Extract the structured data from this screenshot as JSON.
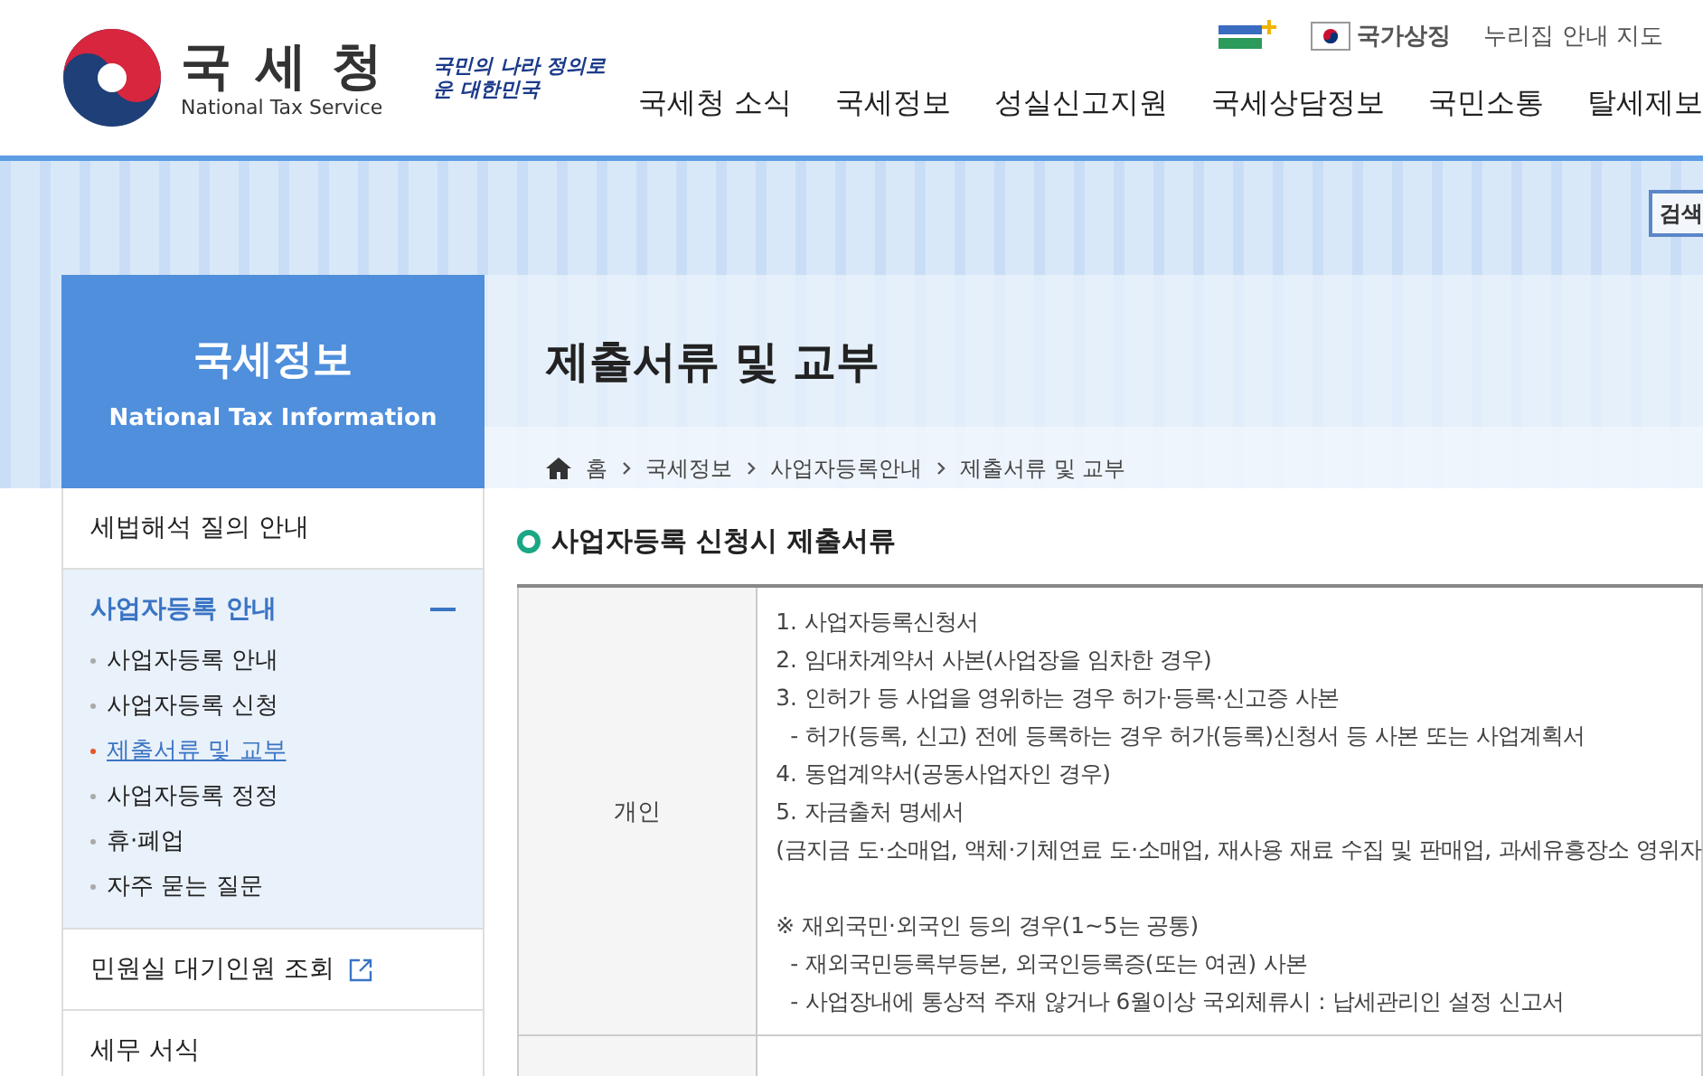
{
  "header": {
    "logo": {
      "title": "국 세 청",
      "subtitle": "National Tax Service"
    },
    "slogan": "국민의 나라 정의로운 대한민국",
    "util_links": [
      {
        "kind": "flag",
        "label": "국가상징"
      },
      {
        "kind": "text",
        "label": "누리집 안내 지도"
      }
    ],
    "nav": [
      "국세청 소식",
      "국세정보",
      "성실신고지원",
      "국세상담정보",
      "국민소통",
      "탈세제보"
    ]
  },
  "banner": {
    "search_button": "검색"
  },
  "sidebar": {
    "title": "국세정보",
    "subtitle": "National Tax Information",
    "items": [
      {
        "label": "세법해석 질의 안내",
        "kind": "plain",
        "expanded": false
      },
      {
        "label": "사업자등록 안내",
        "kind": "plain",
        "expanded": true,
        "children": [
          {
            "label": "사업자등록 안내",
            "selected": false
          },
          {
            "label": "사업자등록 신청",
            "selected": false
          },
          {
            "label": "제출서류 및 교부",
            "selected": true
          },
          {
            "label": "사업자등록 정정",
            "selected": false
          },
          {
            "label": "휴·폐업",
            "selected": false
          },
          {
            "label": "자주 묻는 질문",
            "selected": false
          }
        ]
      },
      {
        "label": "민원실 대기인원 조회",
        "kind": "external",
        "expanded": false
      },
      {
        "label": "세무 서식",
        "kind": "plain",
        "expanded": false
      }
    ]
  },
  "content": {
    "title": "제출서류 및 교부",
    "breadcrumb": [
      "홈",
      "국세정보",
      "사업자등록안내",
      "제출서류 및 교부"
    ],
    "section_title": "사업자등록 신청시 제출서류",
    "table": {
      "rows": [
        {
          "header": "개인",
          "lines": [
            {
              "kind": "item",
              "text": "1. 사업자등록신청서"
            },
            {
              "kind": "item",
              "text": "2. 임대차계약서 사본(사업장을 임차한 경우)"
            },
            {
              "kind": "item",
              "text": "3. 인허가 등 사업을 영위하는 경우 허가·등록·신고증 사본"
            },
            {
              "kind": "sub",
              "text": "- 허가(등록, 신고) 전에 등록하는 경우 허가(등록)신청서 등 사본 또는 사업계획서"
            },
            {
              "kind": "item",
              "text": "4. 동업계약서(공동사업자인 경우)"
            },
            {
              "kind": "item",
              "text": "5. 자금출처 명세서"
            },
            {
              "kind": "item",
              "text": "(금지금 도·소매업, 액체·기체연료 도·소매업, 재사용 재료 수집 및 판매업, 과세유흥장소 영위자"
            },
            {
              "kind": "note",
              "text": "※ 재외국민·외국인 등의 경우(1~5는 공통)"
            },
            {
              "kind": "sub",
              "text": "- 재외국민등록부등본, 외국인등록증(또는 여권) 사본"
            },
            {
              "kind": "sub",
              "text": "- 사업장내에 통상적 주재 않거나 6월이상 국외체류시 : 납세관리인 설정 신고서"
            }
          ]
        },
        {
          "header": "",
          "lines": []
        }
      ]
    }
  }
}
